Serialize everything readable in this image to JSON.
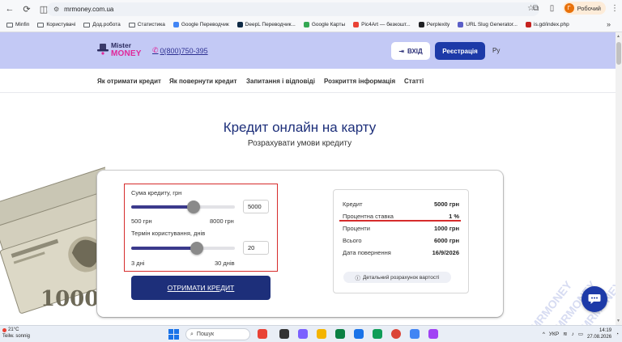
{
  "browser": {
    "url": "mrmoney.com.ua",
    "profile_label": "Робочий",
    "profile_initial": "Г",
    "bookmarks": [
      "Minfin",
      "Користувачі",
      "Дод.робота",
      "Статистика",
      "Google Переводчик",
      "DeepL Переводчик...",
      "Google Карты",
      "Pic4Art — безкошт...",
      "Perplexity",
      "URL Slug Generator...",
      "is.gd/index.php"
    ]
  },
  "header": {
    "logo_top": "Mister",
    "logo_bottom": "MONEY",
    "phone": "0(800)750-395",
    "login_label": "ВХІД",
    "register_label": "Реєстрація",
    "lang": "Ру"
  },
  "nav": [
    "Як отримати кредит",
    "Як повернути кредит",
    "Запитання і відповіді",
    "Розкриття інформація",
    "Статті"
  ],
  "hero": {
    "title": "Кредит онлайн на карту",
    "subtitle": "Розрахувати умови кредиту"
  },
  "calculator": {
    "amount_label": "Сума кредиту, грн",
    "amount_value": "5000",
    "amount_min": "500 грн",
    "amount_max": "8000 грн",
    "amount_level": 0.6,
    "term_label": "Термін користування, днів",
    "term_value": "20",
    "term_min": "3 дні",
    "term_max": "30 днів",
    "term_level": 0.63,
    "button_label": "ОТРИМАТИ КРЕДИТ"
  },
  "summary": {
    "rows": [
      {
        "label": "Кредит",
        "value": "5000 грн"
      },
      {
        "label": "Процентна ставка",
        "value": "1 %"
      },
      {
        "label": "Проценти",
        "value": "1000 грн"
      },
      {
        "label": "Всього",
        "value": "6000 грн"
      },
      {
        "label": "Дата повернення",
        "value": "16/9/2026"
      }
    ],
    "details_label": "Детальний розрахунок вартості"
  },
  "decor": {
    "banknote_value": "1000",
    "watermark_text": "MRMONEY"
  },
  "taskbar": {
    "weather_temp": "21°C",
    "weather_desc": "Teilw. sonnig",
    "search_placeholder": "Пошук",
    "lang": "УКР",
    "time": "14:19",
    "date": "27.08.2026"
  },
  "colors": {
    "header_bg": "#c3c9f5",
    "brand_blue": "#1d3aa8",
    "dark_blue": "#1d2f7a",
    "accent_pink": "#e0289a",
    "annotation_red": "#d62c2c"
  }
}
